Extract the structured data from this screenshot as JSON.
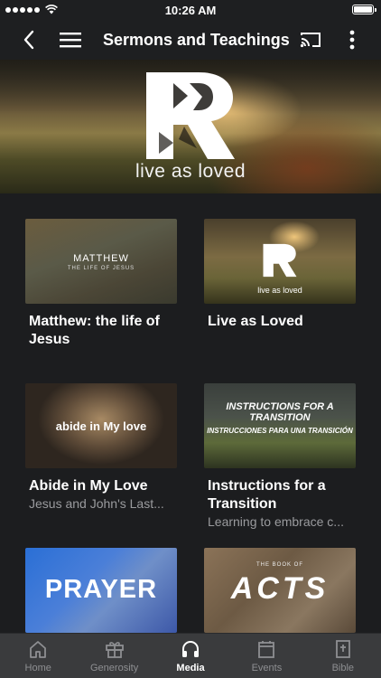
{
  "status": {
    "time": "10:26 AM"
  },
  "nav": {
    "title": "Sermons and Teachings"
  },
  "hero": {
    "tagline": "live as loved"
  },
  "cards": [
    {
      "title": "Matthew: the life of Jesus",
      "subtitle": "",
      "thumb_text": "MATTHEW",
      "thumb_sub": "THE LIFE OF JESUS"
    },
    {
      "title": "Live as Loved",
      "subtitle": "",
      "thumb_text": "live as loved"
    },
    {
      "title": "Abide in My Love",
      "subtitle": "Jesus and John's Last...",
      "thumb_text": "abide in My love"
    },
    {
      "title": "Instructions for a Transition",
      "subtitle": "Learning to embrace c...",
      "thumb_text": "INSTRUCTIONS FOR A TRANSITION",
      "thumb_sub": "INSTRUCCIONES PARA UNA TRANSICIÓN"
    },
    {
      "title": "",
      "subtitle": "",
      "thumb_text": "PRAYER"
    },
    {
      "title": "",
      "subtitle": "",
      "thumb_text": "ACTS",
      "thumb_sub": "THE BOOK OF"
    }
  ],
  "tabs": [
    {
      "label": "Home",
      "icon": "home-icon"
    },
    {
      "label": "Generosity",
      "icon": "gift-icon"
    },
    {
      "label": "Media",
      "icon": "headphones-icon",
      "active": true
    },
    {
      "label": "Events",
      "icon": "calendar-icon"
    },
    {
      "label": "Bible",
      "icon": "bible-icon"
    }
  ],
  "colors": {
    "background": "#1c1d1f",
    "tab_bar": "#3a3b3d",
    "inactive_tab": "#8e8f92",
    "active_tab": "#ffffff"
  }
}
